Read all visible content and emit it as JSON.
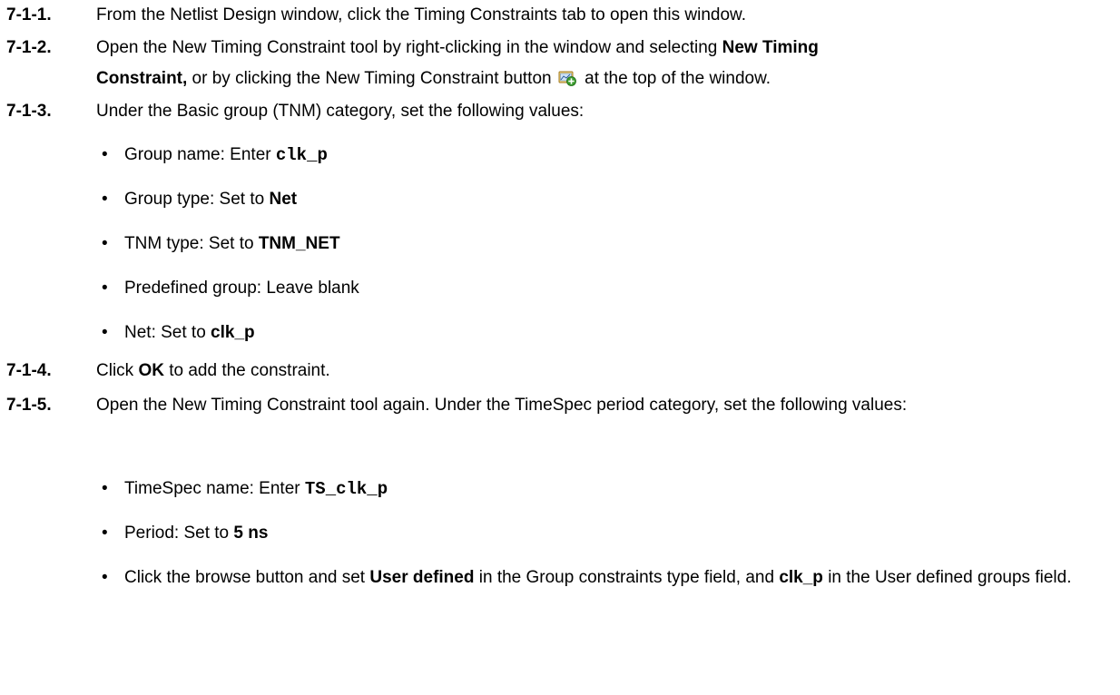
{
  "steps": [
    {
      "num": "7-1-1.",
      "parts": [
        "From the Netlist Design window, click the Timing Constraints tab to open this window."
      ]
    },
    {
      "num": "7-1-2.",
      "line1": [
        "Open the New Timing Constraint tool by right-clicking in the window and selecting ",
        "New Timing"
      ],
      "line2": [
        "Constraint,",
        " or by clicking the New Timing Constraint button ",
        " at the top of the window."
      ],
      "icon": "new-timing-constraint-icon"
    },
    {
      "num": "7-1-3.",
      "parts": [
        "Under the Basic group (TNM) category, set the following values:"
      ]
    },
    {
      "num": "7-1-4.",
      "parts": [
        "Click ",
        "OK",
        " to add the constraint."
      ]
    },
    {
      "num": "7-1-5.",
      "parts": [
        "Open the New Timing Constraint tool again.  Under the TimeSpec period category, set the following values:"
      ]
    }
  ],
  "bullets_basic": [
    {
      "pre": "Group name: Enter ",
      "val": "clk_p"
    },
    {
      "pre": "Group type: Set to ",
      "val": "Net"
    },
    {
      "pre": "TNM type: Set to ",
      "val": "TNM_NET"
    },
    {
      "pre": "Predefined group: Leave blank",
      "val": ""
    },
    {
      "pre": "Net: Set to ",
      "val": "clk_p"
    }
  ],
  "bullets_timespec": [
    {
      "pre": "TimeSpec name: Enter ",
      "val": "TS_clk_p"
    },
    {
      "pre": "Period: Set to ",
      "val": "5 ns"
    },
    {
      "p1": "Click the browse button and set ",
      "b1": "User defined",
      "p2": " in the Group constraints type field, and ",
      "b2": "clk_p",
      "p3": " in the User defined groups field."
    }
  ],
  "bullet_char": "•"
}
